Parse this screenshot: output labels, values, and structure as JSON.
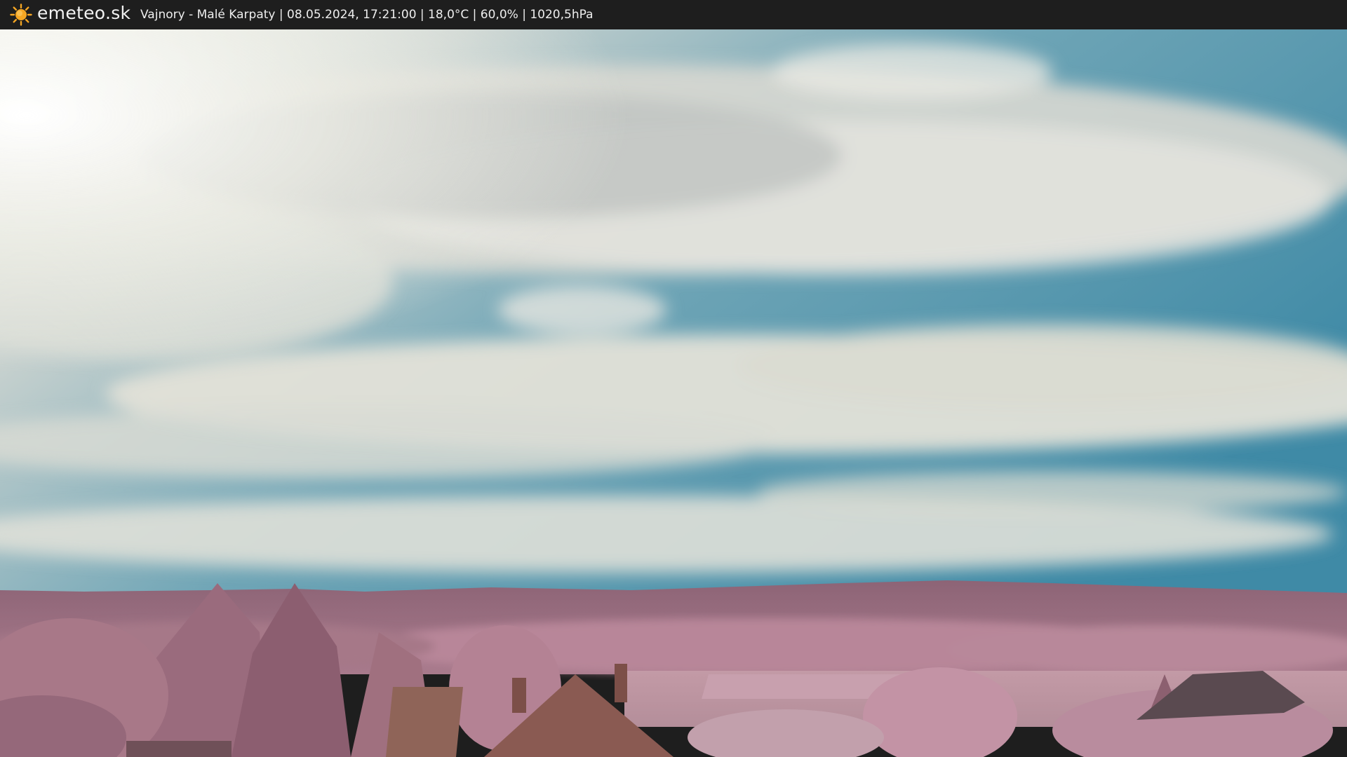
{
  "header": {
    "brand": "emeteo.sk",
    "caption": "Vajnory - Malé Karpaty | 08.05.2024, 17:21:00 | 18,0°C | 60,0% | 1020,5hPa",
    "logo_icon": "sun-icon"
  },
  "colors": {
    "bar": "#1e1e1e",
    "sun": "#f5a623",
    "sky_blue": "#4f97ae",
    "cloud": "#dcdcd4",
    "foliage": "#b0798d",
    "roof": "#8a5a52"
  }
}
